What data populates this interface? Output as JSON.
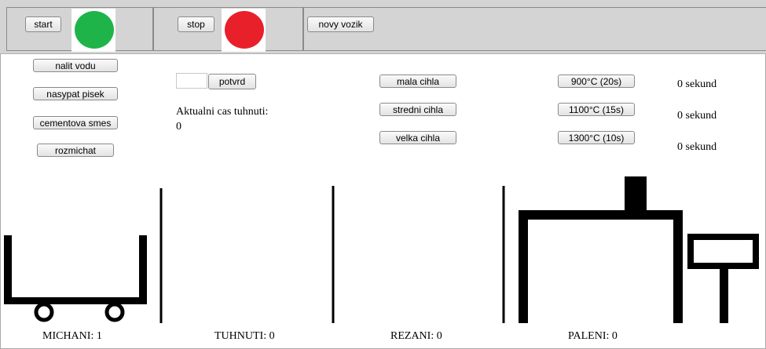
{
  "toolbar": {
    "start_label": "start",
    "stop_label": "stop",
    "new_cart_label": "novy vozik",
    "start_lamp_color": "#1fb44a",
    "stop_lamp_color": "#e8202a"
  },
  "mixing": {
    "buttons": [
      "nalit vodu",
      "nasypat pisek",
      "cementova smes",
      "rozmichat"
    ]
  },
  "hardening": {
    "input_value": "",
    "confirm_label": "potvrd",
    "time_label": "Aktualni cas tuhnuti:",
    "time_value": "0"
  },
  "cutting": {
    "buttons": [
      "mala cihla",
      "stredni cihla",
      "velka cihla"
    ]
  },
  "firing": {
    "buttons": [
      "900°C (20s)",
      "1100°C (15s)",
      "1300°C (10s)"
    ],
    "timers": [
      "0 sekund",
      "0 sekund",
      "0 sekund"
    ]
  },
  "stations": [
    {
      "label": "MICHANI: 1"
    },
    {
      "label": "TUHNUTI: 0"
    },
    {
      "label": "REZANI: 0"
    },
    {
      "label": "PALENI: 0"
    }
  ]
}
